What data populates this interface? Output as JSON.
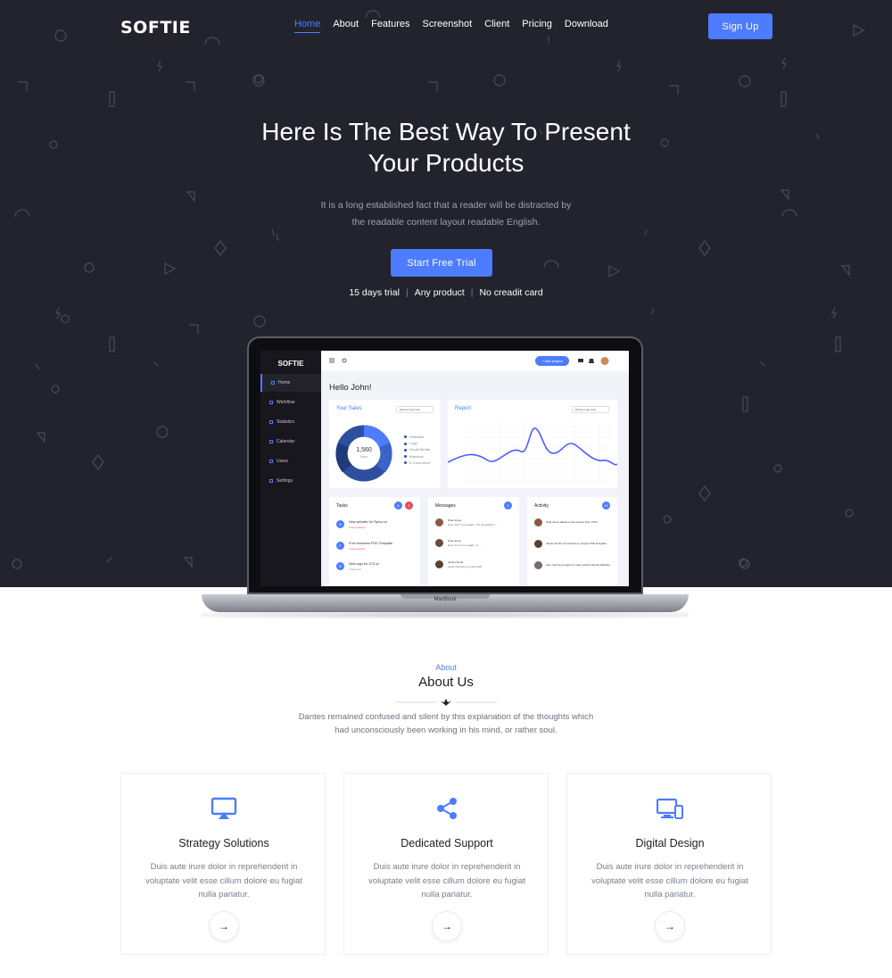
{
  "brand": {
    "logo": "SOFTIE"
  },
  "nav": {
    "items": [
      "Home",
      "About",
      "Features",
      "Screenshot",
      "Client",
      "Pricing",
      "Download"
    ],
    "active": "Home",
    "signup_label": "Sign Up"
  },
  "hero": {
    "title_line1": "Here Is The Best Way To Present",
    "title_line2": "Your Products",
    "subtitle_line1": "It is a long established fact that a reader will be distracted by",
    "subtitle_line2": "the readable content layout readable English.",
    "cta_label": "Start Free Trial",
    "meta": [
      "15 days trial",
      "Any product",
      "No creadit card"
    ]
  },
  "mockup": {
    "brand": "SOFTIE",
    "device_label": "MacBook",
    "sidebar": [
      "Home",
      "Workflow",
      "Statistics",
      "Calendar",
      "Users",
      "Settings"
    ],
    "add_project": "+ Add project",
    "greeting": "Hello John!",
    "sales": {
      "title": "Your Sales",
      "period": "Period: Last Year",
      "center_value": "1,560",
      "center_label": "Sales",
      "legend": [
        "Websites",
        "Logo",
        "Social Media",
        "Adwords",
        "E-Commerce"
      ]
    },
    "report": {
      "title": "Report",
      "period": "Period: Last Year"
    },
    "tasks": {
      "title": "Tasks",
      "badges": [
        "6",
        "2"
      ],
      "items": [
        {
          "letter": "N",
          "text": "New website for Symu.co",
          "sub": "5 days delays"
        },
        {
          "letter": "F",
          "text": "Free business PSD Template",
          "sub": "2 days delays"
        },
        {
          "letter": "N",
          "text": "New logo for JCD.pl",
          "sub": "5 days left"
        }
      ]
    },
    "messages": {
      "title": "Messages",
      "badge": "2",
      "items": [
        {
          "name": "Nina Jones",
          "text": "Hey! You! I'm so again : (I'll remember it ..."
        },
        {
          "name": "Nina Jones",
          "text": "Hey! You! I'm so again : (I ..."
        },
        {
          "name": "James Smith",
          "text": "Good morning, you are fired!"
        }
      ]
    },
    "activity": {
      "title": "Activity",
      "badge": "10",
      "items": [
        {
          "text": "Nina Jones added a new project Free UI Kit"
        },
        {
          "text": "James Smith commented on project PSD Template"
        },
        {
          "text": "Alex Clooney bought our new product Simple Website"
        }
      ]
    }
  },
  "about": {
    "kicker": "About",
    "title": "About Us",
    "text_line1": "Dantes remained confused and silent by this explanation of the thoughts which",
    "text_line2": "had unconsciously been working in his mind, or rather soul."
  },
  "features": [
    {
      "icon": "monitor-cast-icon",
      "title": "Strategy Solutions",
      "line1": "Duis aute irure dolor in reprehenderit in",
      "line2": "voluptate velit esse cillum dolore eu fugiat",
      "line3": "nulla pariatur."
    },
    {
      "icon": "share-icon",
      "title": "Dedicated Support",
      "line1": "Duis aute irure dolor in reprehenderit in",
      "line2": "voluptate velit esse cillum dolore eu fugiat",
      "line3": "nulla pariatur."
    },
    {
      "icon": "devices-icon",
      "title": "Digital Design",
      "line1": "Duis aute irure dolor in reprehenderit in",
      "line2": "voluptate velit esse cillum dolore eu fugiat",
      "line3": "nulla pariatur."
    }
  ],
  "colors": {
    "accent": "#4d7cff",
    "hero_bg": "#23232e",
    "heading": "#1c1c24",
    "body_text": "#7a7d8a"
  }
}
